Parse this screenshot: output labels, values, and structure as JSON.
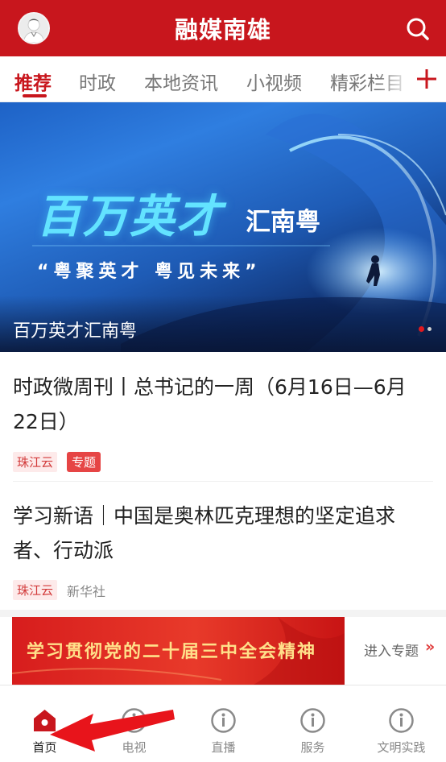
{
  "header": {
    "title": "融媒南雄",
    "avatar_icon": "user-avatar-icon",
    "search_icon": "search-icon",
    "background_color": "#c8161d"
  },
  "tabs": {
    "items": [
      {
        "label": "推荐",
        "active": true
      },
      {
        "label": "时政",
        "active": false
      },
      {
        "label": "本地资讯",
        "active": false
      },
      {
        "label": "小视频",
        "active": false
      },
      {
        "label": "精彩栏目",
        "active": false
      }
    ],
    "add_icon": "plus-icon"
  },
  "banner": {
    "headline": "百万英才",
    "subheadline": "汇南粤",
    "slogan": "“粤聚英才 粤见未来”",
    "caption": "百万英才汇南粤",
    "slide_count": 2,
    "active_slide": 1
  },
  "articles": [
    {
      "title": "时政微周刊丨总书记的一周（6月16日—6月22日）",
      "tags": [
        "珠江云",
        "专题"
      ],
      "source": ""
    },
    {
      "title": "学习新语｜中国是奥林匹克理想的坚定追求者、行动派",
      "tags": [
        "珠江云"
      ],
      "source": "新华社"
    }
  ],
  "topic": {
    "banner_text": "学习贯彻党的二十届三中全会精神",
    "link_label": "进入专题",
    "link_arrow": "»"
  },
  "bottom_nav": {
    "items": [
      {
        "label": "首页",
        "icon": "home-icon",
        "active": true
      },
      {
        "label": "电视",
        "icon": "info-circle-icon",
        "active": false
      },
      {
        "label": "直播",
        "icon": "info-circle-icon",
        "active": false
      },
      {
        "label": "服务",
        "icon": "info-circle-icon",
        "active": false
      },
      {
        "label": "文明实践",
        "icon": "info-circle-icon",
        "active": false
      }
    ]
  },
  "colors": {
    "brand_red": "#c8161d",
    "tag_red": "#e64545",
    "annotation_red": "#e8141b"
  }
}
